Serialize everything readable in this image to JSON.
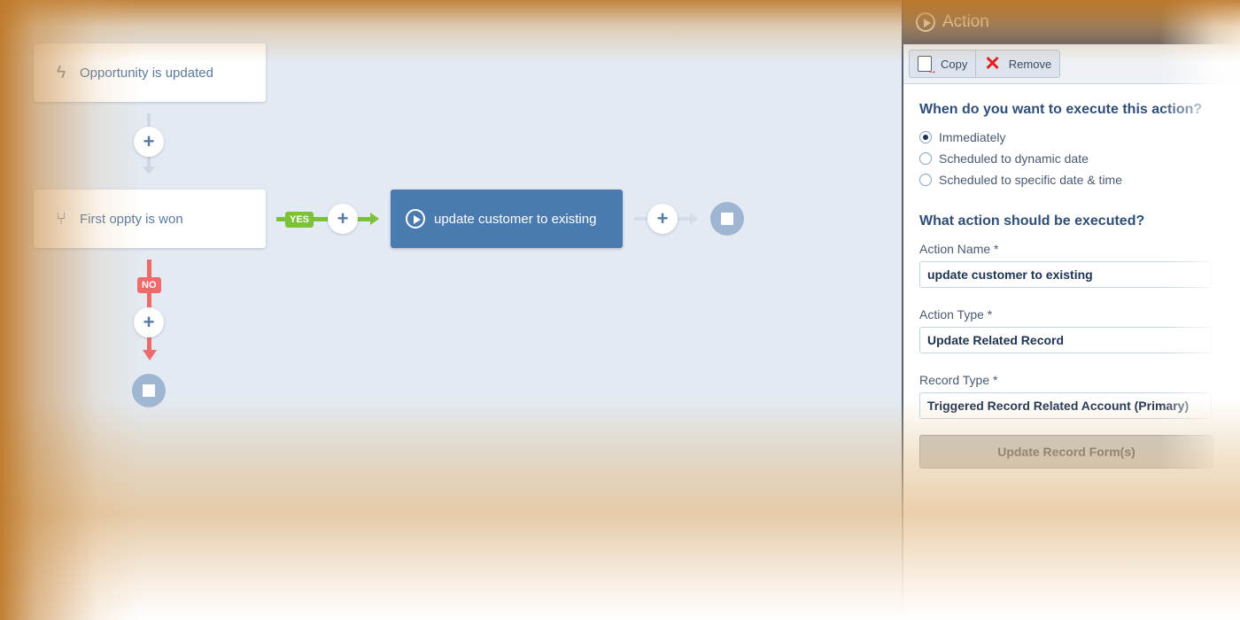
{
  "canvas": {
    "trigger": {
      "label": "Opportunity is updated",
      "icon": "lightning-icon"
    },
    "condition": {
      "label": "First oppty is won",
      "icon": "branch-icon"
    },
    "yes_label": "YES",
    "no_label": "NO",
    "action": {
      "label": "update customer to existing",
      "icon": "play-icon"
    },
    "plus_symbol": "+",
    "colors": {
      "action": "#4a7bb0",
      "yes": "#7cc13a",
      "no": "#ee6b6b",
      "stop": "#9fb6d3"
    }
  },
  "panel": {
    "title": "Action",
    "toolbar": {
      "copy_label": "Copy",
      "remove_label": "Remove"
    },
    "when_title": "When do you want to execute this action?",
    "when_options": [
      {
        "label": "Immediately",
        "checked": true
      },
      {
        "label": "Scheduled to dynamic date",
        "checked": false
      },
      {
        "label": "Scheduled to specific date & time",
        "checked": false
      }
    ],
    "what_title": "What action should be executed?",
    "action_name_label": "Action Name *",
    "action_name_value": "update customer to existing",
    "action_type_label": "Action Type *",
    "action_type_value": "Update Related Record",
    "record_type_label": "Record Type *",
    "record_type_value": "Triggered Record Related Account (Primary)",
    "form_button_label": "Update Record Form(s)"
  }
}
